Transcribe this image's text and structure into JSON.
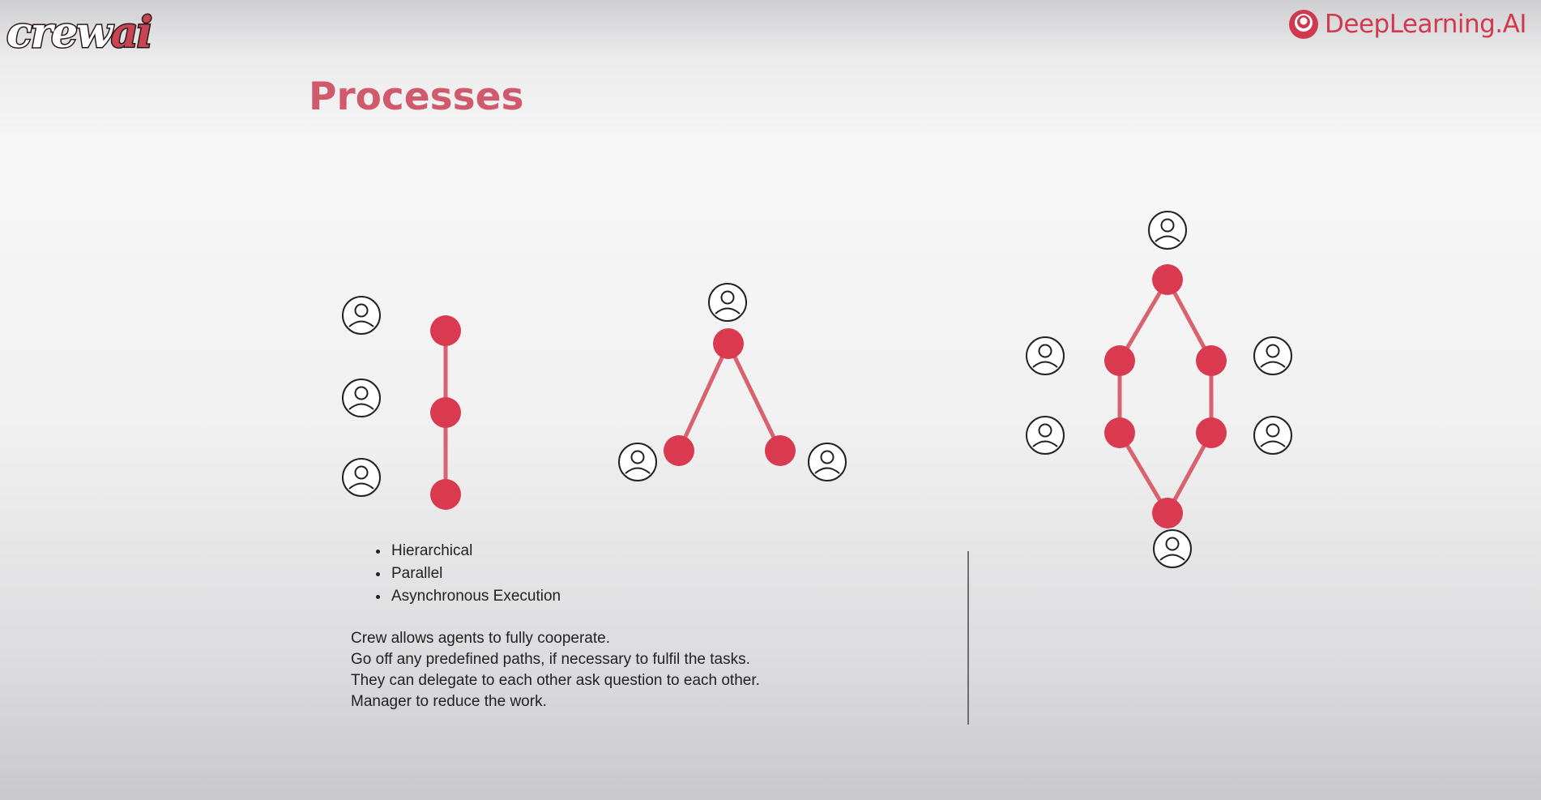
{
  "brand": {
    "crew_logo_text": "crew",
    "crew_logo_accent": "ai",
    "dl_logo_text": "DeepLearning.AI"
  },
  "slide": {
    "title": "Processes",
    "bullets": [
      "Hierarchical",
      "Parallel",
      "Asynchronous Execution"
    ],
    "description": [
      "Crew allows agents to fully cooperate.",
      "Go off any predefined paths, if necessary to fulfil the tasks.",
      "They can delegate to each other ask question to each other.",
      "Manager to reduce the work."
    ]
  },
  "colors": {
    "accent": "#d13a4e",
    "title": "#d05a6b",
    "node": "#d93a4f",
    "edge": "#d9626f"
  },
  "icons": {
    "agent": "user-circle-icon",
    "node": "task-node-icon"
  }
}
